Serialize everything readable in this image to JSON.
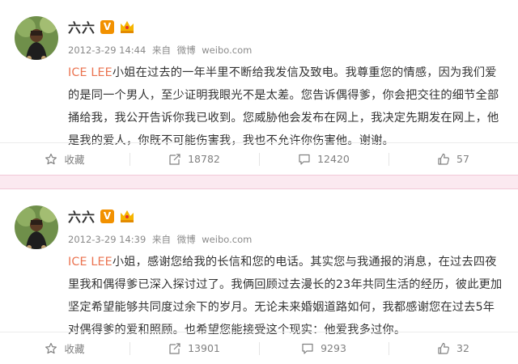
{
  "posts": [
    {
      "username": "六六",
      "verified_badge": "V",
      "member_badge_icon": "crown-badge-icon",
      "timestamp": "2012-3-29 14:44",
      "via_label": "来自",
      "source": "微博",
      "source_url": "weibo.com",
      "mention": "ICE LEE",
      "text": "小姐在过去的一年半里不断给我发信及致电。我尊重您的情感，因为我们爱的是同一个男人，至少证明我眼光不是太差。您告诉偶得爹，你会把交往的细节全部捅给我，我公开告诉你我已收到。您威胁他会发布在网上，我决定先期发在网上，他是我的爱人，你既不可能伤害我，我也不允许你伤害他。谢谢。",
      "actions": {
        "favorite_label": "收藏",
        "repost_count": "18782",
        "comment_count": "12420",
        "like_count": "57"
      }
    },
    {
      "username": "六六",
      "verified_badge": "V",
      "member_badge_icon": "crown-badge-icon",
      "timestamp": "2012-3-29 14:39",
      "via_label": "来自",
      "source": "微博",
      "source_url": "weibo.com",
      "mention": "ICE LEE",
      "text": "小姐，感谢您给我的长信和您的电话。其实您与我通报的消息，在过去四夜里我和偶得爹已深入探讨过了。我俩回顾过去漫长的23年共同生活的经历，彼此更加坚定希望能够共同度过余下的岁月。无论未来婚姻道路如何，我都感谢您在过去5年对偶得爹的爱和照顾。也希望您能接受这个现实：他爱我多过你。",
      "actions": {
        "favorite_label": "收藏",
        "repost_count": "13901",
        "comment_count": "9293",
        "like_count": "32"
      }
    }
  ],
  "colors": {
    "mention": "#eb7350",
    "divider": "#fbe9f0",
    "verified": "#f29100"
  }
}
